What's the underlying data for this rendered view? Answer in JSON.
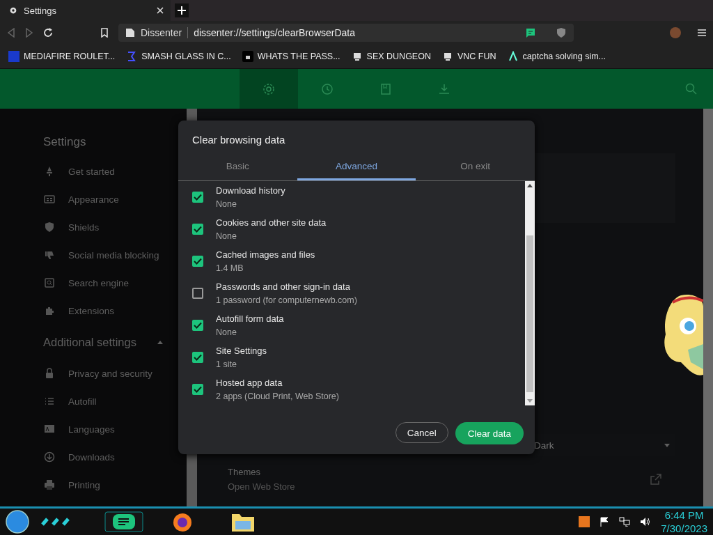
{
  "browser_tab": {
    "title": "Settings"
  },
  "address_bar": {
    "site": "Dissenter",
    "url": "dissenter://settings/clearBrowserData"
  },
  "bookmarks": [
    "MEDIAFIRE ROULET...",
    "SMASH GLASS IN C...",
    "WHATS THE PASS...",
    "SEX DUNGEON",
    "VNC FUN",
    "captcha solving sim..."
  ],
  "header_nav": [
    {
      "selected": true
    },
    {
      "selected": false
    },
    {
      "selected": false
    },
    {
      "selected": false
    }
  ],
  "sidebar": {
    "title": "Settings",
    "items": [
      "Get started",
      "Appearance",
      "Shields",
      "Social media blocking",
      "Search engine",
      "Extensions"
    ],
    "section": {
      "title": "Additional settings",
      "expanded": true,
      "items": [
        "Privacy and security",
        "Autofill",
        "Languages",
        "Downloads",
        "Printing"
      ]
    }
  },
  "content": {
    "color_value": "Dark",
    "themes_title": "Themes",
    "themes_subtitle": "Open Web Store"
  },
  "dialog": {
    "title": "Clear browsing data",
    "tabs": [
      {
        "label": "Basic",
        "selected": false
      },
      {
        "label": "Advanced",
        "selected": true
      },
      {
        "label": "On exit",
        "selected": false
      }
    ],
    "items": [
      {
        "label": "Download history",
        "detail": "None",
        "checked": true
      },
      {
        "label": "Cookies and other site data",
        "detail": "None",
        "checked": true
      },
      {
        "label": "Cached images and files",
        "detail": "1.4 MB",
        "checked": true
      },
      {
        "label": "Passwords and other sign-in data",
        "detail": "1 password (for computernewb.com)",
        "checked": false
      },
      {
        "label": "Autofill form data",
        "detail": "None",
        "checked": true
      },
      {
        "label": "Site Settings",
        "detail": "1 site",
        "checked": true
      },
      {
        "label": "Hosted app data",
        "detail": "2 apps (Cloud Print, Web Store)",
        "checked": true
      }
    ],
    "buttons": {
      "cancel": "Cancel",
      "confirm": "Clear data"
    }
  },
  "taskbar": {
    "time": "6:44 PM",
    "date": "7/30/2023"
  }
}
